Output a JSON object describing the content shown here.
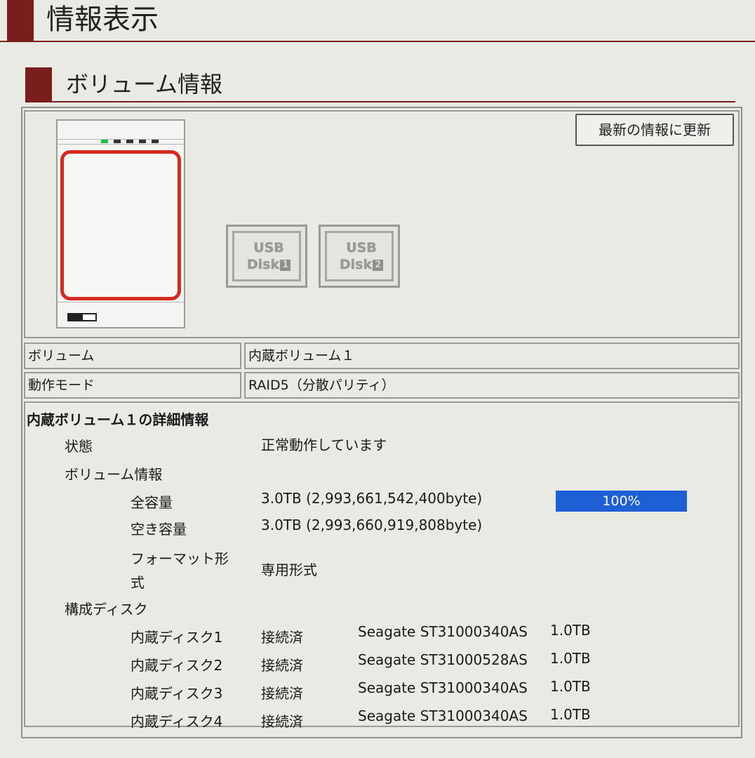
{
  "page_title": "情報表示",
  "section_title": "ボリューム情報",
  "refresh_button": "最新の情報に更新",
  "usb_disks": [
    {
      "line1": "USB",
      "line2": "Disk",
      "number": "1"
    },
    {
      "line1": "USB",
      "line2": "Disk",
      "number": "2"
    }
  ],
  "volume_row": {
    "label": "ボリューム",
    "value": "内蔵ボリューム１"
  },
  "mode_row": {
    "label": "動作モード",
    "value": "RAID5（分散パリティ）"
  },
  "detail": {
    "title": "内蔵ボリューム１の詳細情報",
    "status_label": "状態",
    "status_value": "正常動作しています",
    "volume_info_label": "ボリューム情報",
    "total_label": "全容量",
    "total_value": "3.0TB (2,993,661,542,400byte)",
    "free_label": "空き容量",
    "free_value": "3.0TB (2,993,660,919,808byte)",
    "usage_percent_label": "100%",
    "usage_fraction": 1.0,
    "format_label_line1": "フォーマット形",
    "format_label_line2": "式",
    "format_value": "専用形式",
    "disks_label": "構成ディスク",
    "disks": [
      {
        "name": "内蔵ディスク1",
        "status": "接続済",
        "model": "Seagate ST31000340AS",
        "size": "1.0TB"
      },
      {
        "name": "内蔵ディスク2",
        "status": "接続済",
        "model": "Seagate ST31000528AS",
        "size": "1.0TB"
      },
      {
        "name": "内蔵ディスク3",
        "status": "接続済",
        "model": "Seagate ST31000340AS",
        "size": "1.0TB"
      },
      {
        "name": "内蔵ディスク4",
        "status": "接続済",
        "model": "Seagate ST31000340AS",
        "size": "1.0TB"
      }
    ]
  },
  "colors": {
    "accent": "#7a1d1d",
    "progress": "#1e5fd6",
    "bay_outline": "#d42a1f",
    "led_active": "#1fbf3a"
  }
}
